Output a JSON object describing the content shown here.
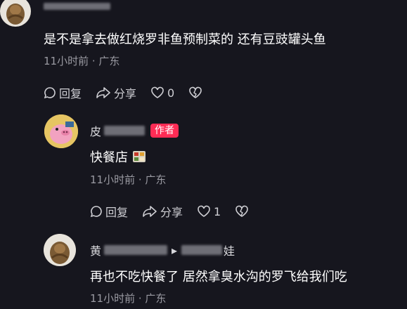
{
  "comments": [
    {
      "user": {
        "name_visible": "",
        "name_tail": ""
      },
      "text": "是不是拿去做红烧罗非鱼预制菜的 还有豆豉罐头鱼",
      "meta": "11小时前 · 广东",
      "actions": {
        "reply": "回复",
        "share": "分享",
        "likes": "0"
      }
    },
    {
      "user": {
        "name_visible": "皮",
        "badge": "作者"
      },
      "text": "快餐店",
      "meta": "11小时前 · 广东",
      "actions": {
        "reply": "回复",
        "share": "分享",
        "likes": "1"
      }
    },
    {
      "user": {
        "name_visible": "黄",
        "name_tail": "娃"
      },
      "text": "再也不吃快餐了  居然拿臭水沟的罗飞给我们吃",
      "meta": "11小时前 · 广东"
    }
  ],
  "icons": {
    "reply": "comment-bubble-icon",
    "share": "share-arrow-icon",
    "like": "heart-icon",
    "dislike": "broken-heart-icon",
    "sticker": "food-box-sticker-icon"
  },
  "colors": {
    "background": "#16161e",
    "accent": "#fe2c55",
    "meta": "#9a9aa2"
  }
}
